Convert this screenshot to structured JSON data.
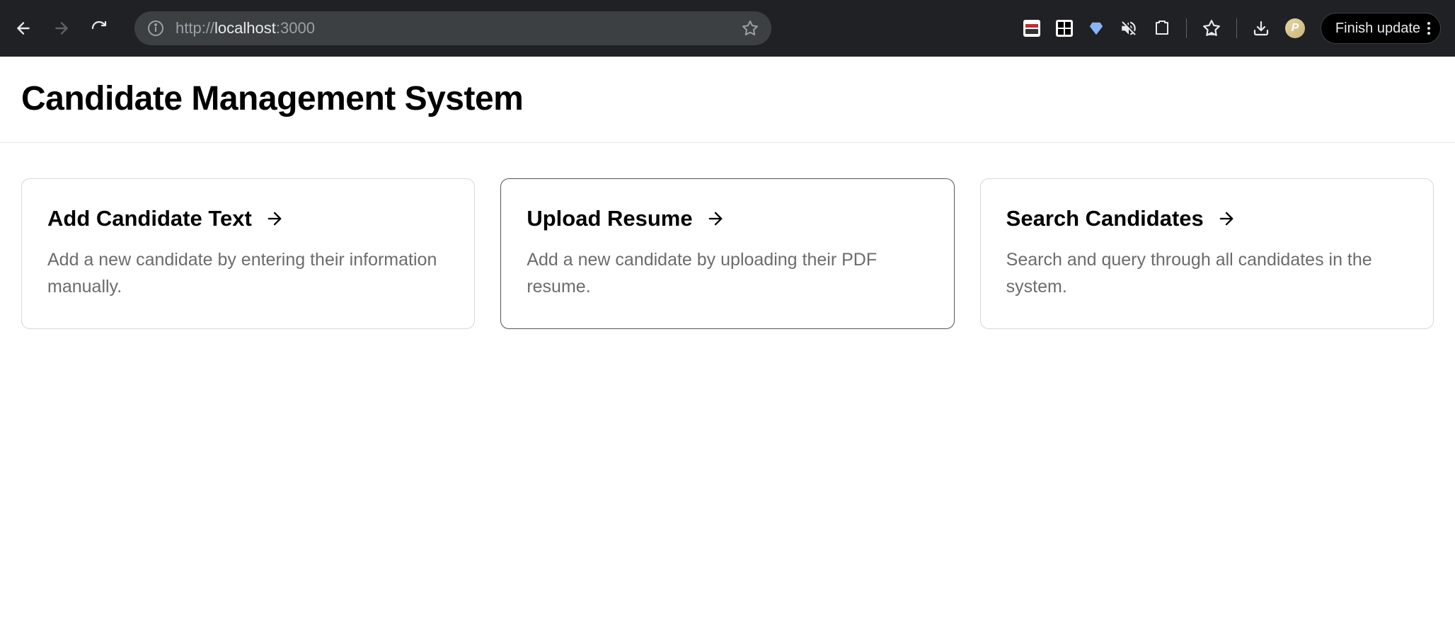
{
  "browser": {
    "url_protocol": "http://",
    "url_host": "localhost",
    "url_port": ":3000",
    "finish_update_label": "Finish update",
    "avatar_letter": "P"
  },
  "page": {
    "title": "Candidate Management System"
  },
  "cards": [
    {
      "title": "Add Candidate Text",
      "description": "Add a new candidate by entering their information manually."
    },
    {
      "title": "Upload Resume",
      "description": "Add a new candidate by uploading their PDF resume."
    },
    {
      "title": "Search Candidates",
      "description": "Search and query through all candidates in the system."
    }
  ]
}
